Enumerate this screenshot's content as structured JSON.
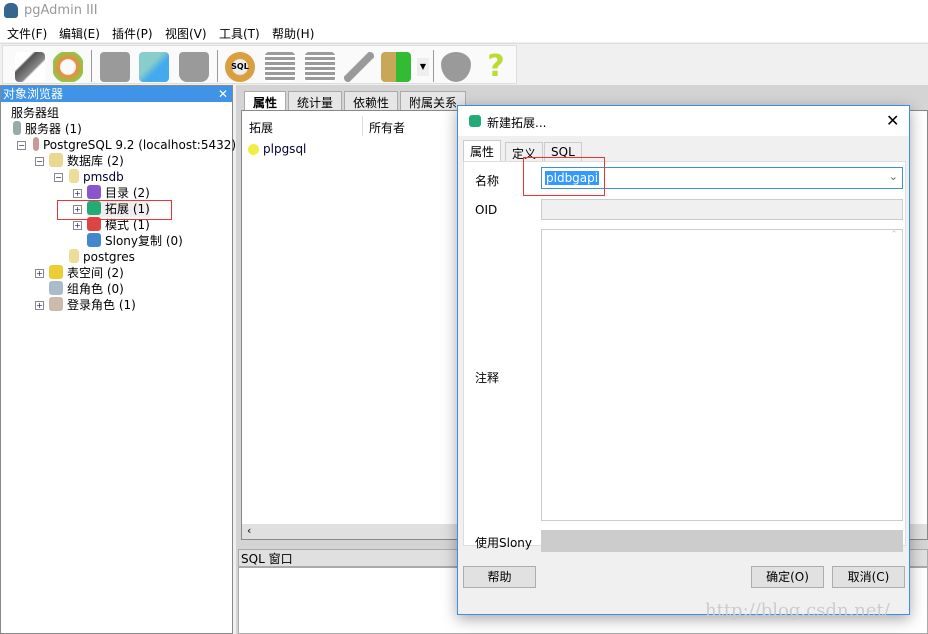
{
  "app": {
    "title": "pgAdmin III"
  },
  "menu": [
    "文件(F)",
    "编辑(E)",
    "插件(P)",
    "视图(V)",
    "工具(T)",
    "帮助(H)"
  ],
  "toolbar": [
    "connect-icon",
    "refresh-icon",
    "create-icon",
    "properties-icon",
    "delete-icon",
    "sql-query-icon",
    "view-data-icon",
    "filtered-data-icon",
    "maintenance-icon",
    "plugins-icon",
    "plugins-dropdown-icon",
    "hint-icon",
    "help-icon"
  ],
  "browser": {
    "title": "对象浏览器",
    "nodes": [
      "服务器组",
      "服务器 (1)",
      "PostgreSQL 9.2 (localhost:5432)",
      "数据库 (2)",
      "pmsdb",
      "目录 (2)",
      "拓展 (1)",
      "模式 (1)",
      "Slony复制 (0)",
      "postgres",
      "表空间 (2)",
      "组角色 (0)",
      "登录角色 (1)"
    ]
  },
  "main": {
    "tabs": [
      "属性",
      "统计量",
      "依赖性",
      "附属关系"
    ],
    "columns": [
      "拓展",
      "所有者"
    ],
    "rows": [
      {
        "name": "plpgsql",
        "owner": ""
      }
    ],
    "sql_title": "SQL 窗口"
  },
  "dialog": {
    "title": "新建拓展...",
    "tabs": [
      "属性",
      "定义",
      "SQL"
    ],
    "labels": {
      "name": "名称",
      "oid": "OID",
      "comment": "注释",
      "slony": "使用Slony"
    },
    "name_value": "pldbgapi",
    "buttons": {
      "help": "帮助",
      "ok": "确定(O)",
      "cancel": "取消(C)"
    }
  },
  "watermark": "http://blog.csdn.net/"
}
